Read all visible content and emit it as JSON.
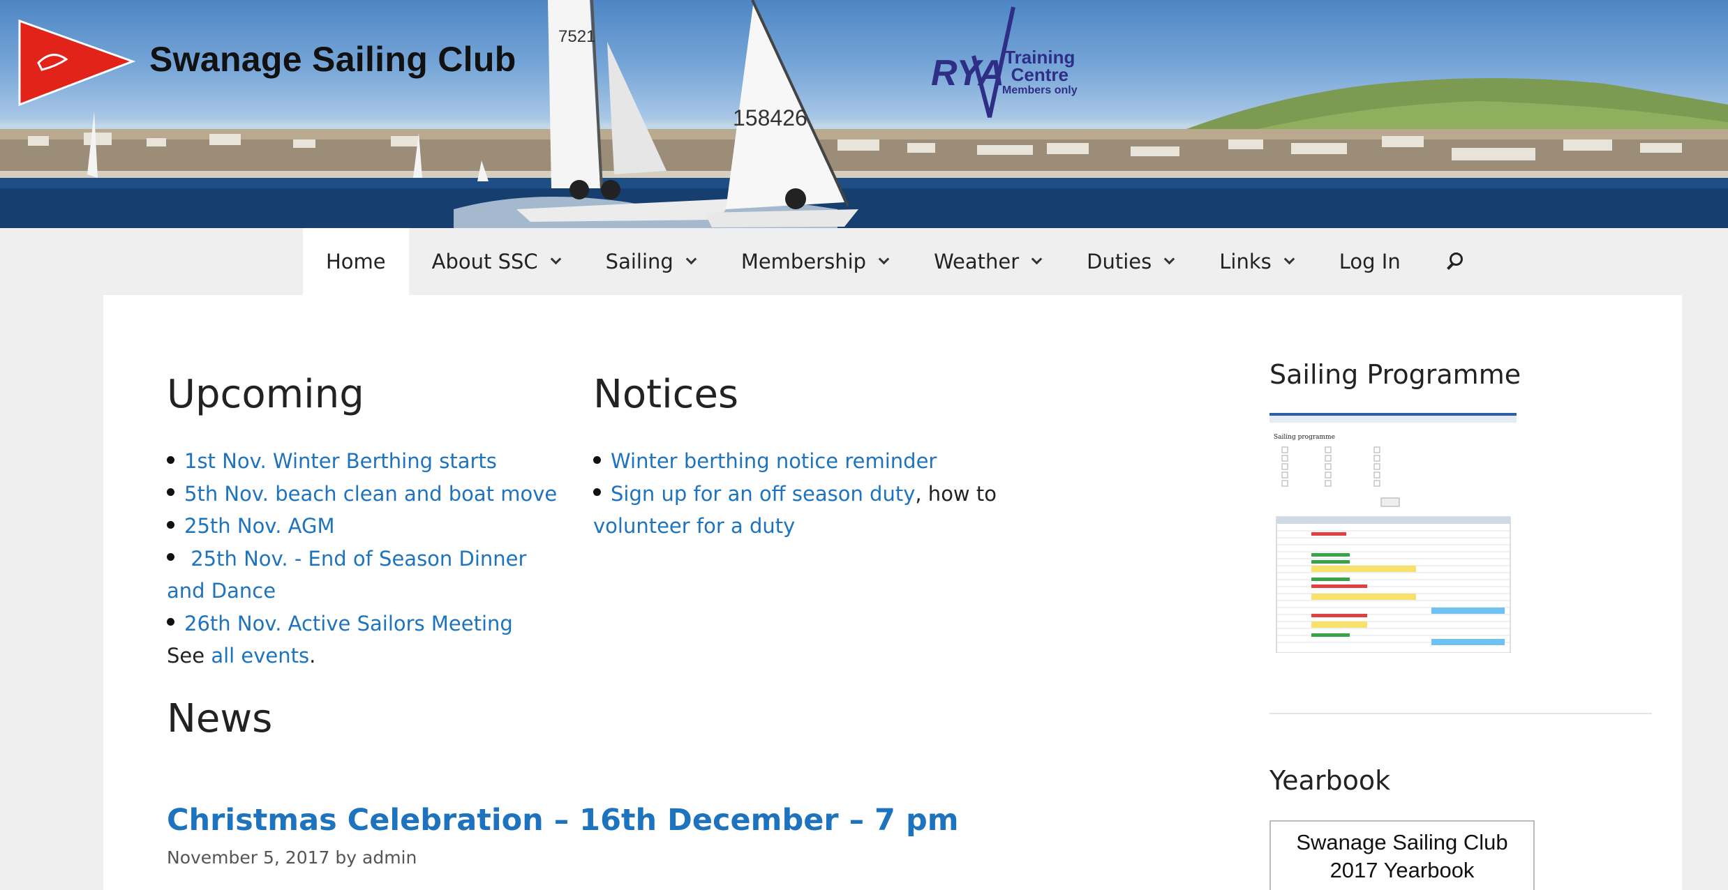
{
  "header": {
    "club_name": "Swanage Sailing Club",
    "rya_logo_text": "RYA",
    "rya_line1": "Training",
    "rya_line2": "Centre",
    "rya_line3": "Members only",
    "sail_number_1": "7521",
    "sail_number_2": "158426"
  },
  "nav": {
    "items": [
      {
        "label": "Home",
        "dropdown": false,
        "active": true
      },
      {
        "label": "About SSC",
        "dropdown": true
      },
      {
        "label": "Sailing",
        "dropdown": true
      },
      {
        "label": "Membership",
        "dropdown": true
      },
      {
        "label": "Weather",
        "dropdown": true
      },
      {
        "label": "Duties",
        "dropdown": true
      },
      {
        "label": "Links",
        "dropdown": true
      },
      {
        "label": "Log In",
        "dropdown": false
      }
    ],
    "search_icon": "search-icon"
  },
  "upcoming": {
    "title": "Upcoming",
    "items": [
      "1st Nov. Winter Berthing starts",
      "5th Nov. beach clean and boat move",
      "25th Nov. AGM",
      " 25th Nov. - End of Season Dinner and Dance",
      "26th Nov. Active Sailors Meeting"
    ],
    "see_prefix": "See ",
    "see_link": "all events",
    "see_suffix": "."
  },
  "notices": {
    "title": "Notices",
    "item1": "Winter berthing notice reminder",
    "item2_link": "Sign up for an off season duty",
    "item2_text": ", how to ",
    "item2_link2": "volunteer for a duty"
  },
  "news": {
    "title": "News",
    "post_title": "Christmas Celebration – 16th December – 7 pm",
    "post_date": "November 5, 2017",
    "post_by": " by ",
    "post_author": "admin"
  },
  "sidebar": {
    "programme_title": "Sailing Programme",
    "programme_heading": "Sailing programme",
    "yearbook_title": "Yearbook",
    "yearbook_line1": "Swanage Sailing Club",
    "yearbook_line2": "2017 Yearbook"
  },
  "colors": {
    "link": "#1e73be",
    "nav_bg": "#efefef",
    "flag_red": "#e2231a",
    "rya_blue": "#2e2e86"
  }
}
